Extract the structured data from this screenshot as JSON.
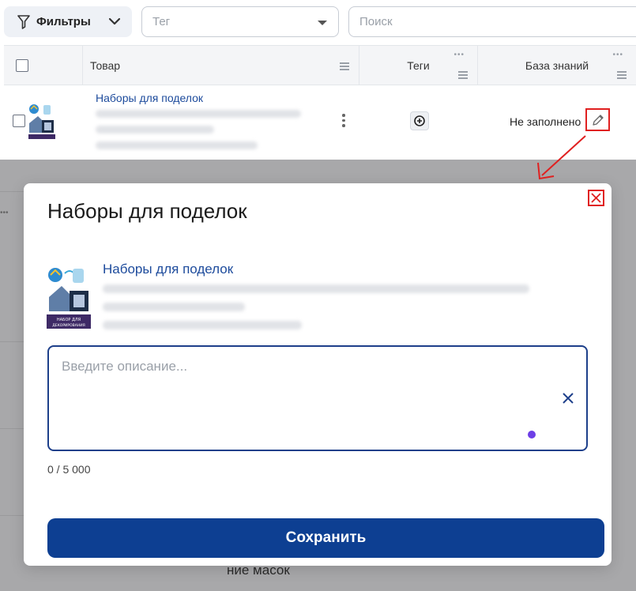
{
  "toolbar": {
    "filters_label": "Фильтры",
    "tag_placeholder": "Тег",
    "search_placeholder": "Поиск"
  },
  "table": {
    "columns": {
      "product": "Товар",
      "tags": "Теги",
      "knowledge_base": "База знаний"
    },
    "row": {
      "product_name": "Наборы для поделок",
      "knowledge_status": "Не заполнено"
    }
  },
  "background": {
    "partial_text": "ние масок"
  },
  "modal": {
    "title": "Наборы для поделок",
    "product_name": "Наборы для поделок",
    "thumb_badge_line1": "НАБОР ДЛЯ",
    "thumb_badge_line2": "ДЕКОРИРОВАНИЯ",
    "description_placeholder": "Введите описание...",
    "char_count": "0 / 5 000",
    "save_label": "Сохранить"
  },
  "colors": {
    "primary": "#0d3f92",
    "link": "#1d4b9c",
    "highlight": "#e02020",
    "indicator": "#6d3fe6",
    "overlay": "#a8a8aa"
  }
}
